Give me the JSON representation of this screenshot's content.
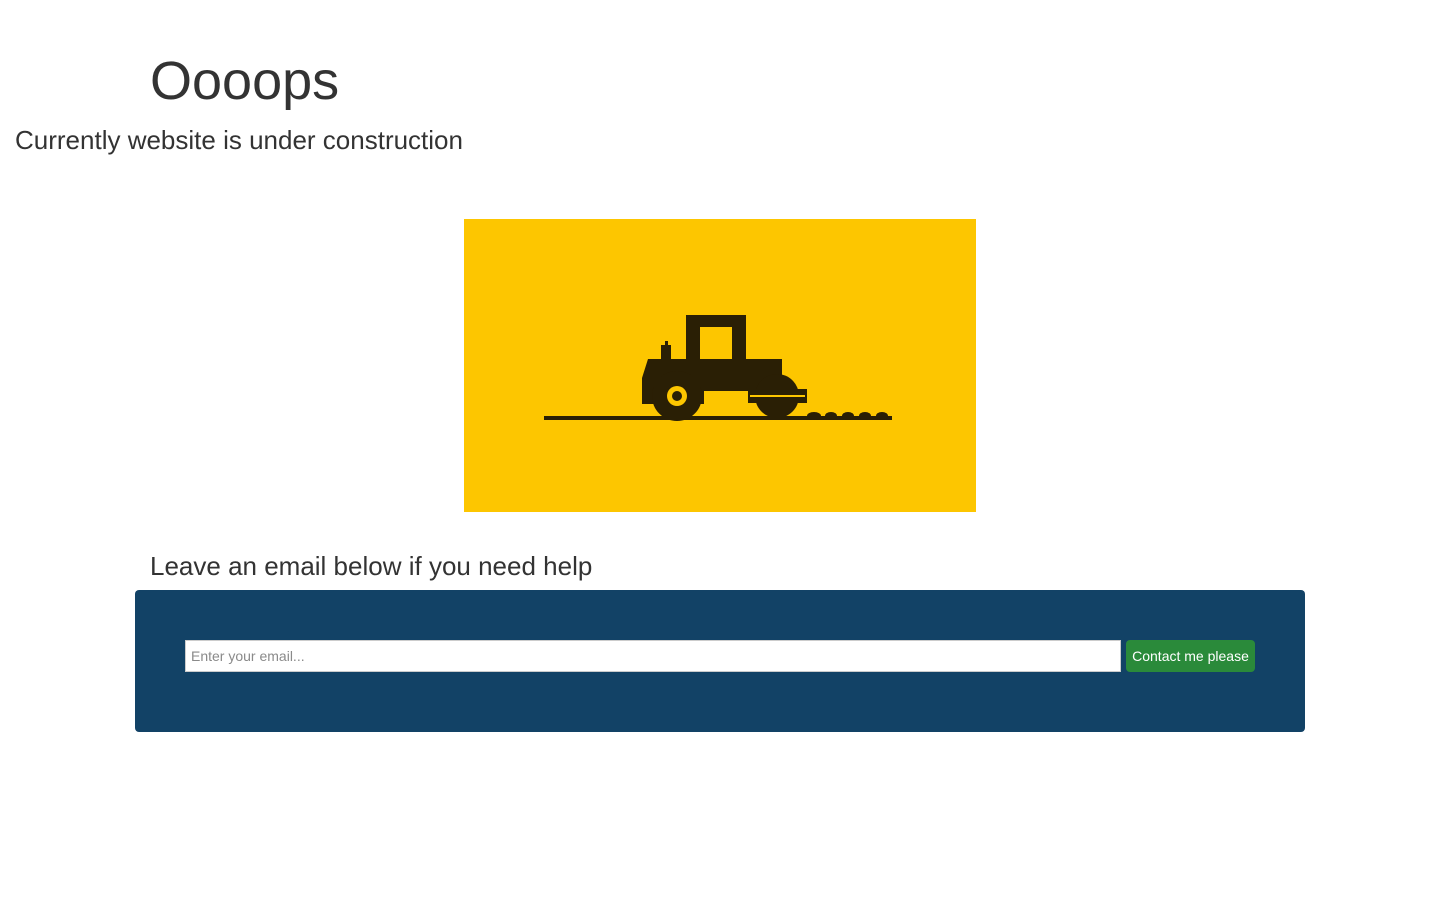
{
  "header": {
    "title": "Oooops",
    "subtitle": "Currently website is under construction"
  },
  "illustration": {
    "icon": "road-roller-icon",
    "background_color": "#fdc600",
    "foreground_color": "#2a1f05"
  },
  "help": {
    "heading": "Leave an email below if you need help"
  },
  "form": {
    "panel_color": "#124266",
    "email_value": "",
    "email_placeholder": "Enter your email...",
    "submit_label": "Contact me please",
    "submit_color": "#2a8a3a"
  }
}
